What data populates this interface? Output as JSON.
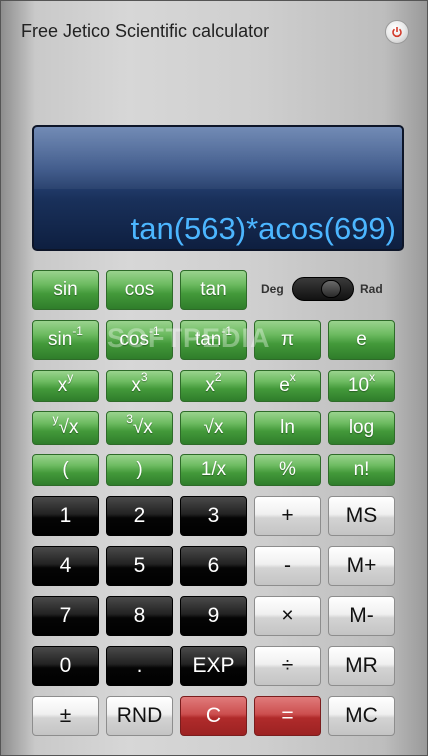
{
  "window": {
    "title": "Free Jetico Scientific calculator"
  },
  "display": {
    "expression": "tan(563)*acos(699)"
  },
  "angle_mode": {
    "deg_label": "Deg",
    "rad_label": "Rad",
    "selected": "Rad"
  },
  "watermark": "SOFTPEDIA",
  "buttons": {
    "sin": "sin",
    "cos": "cos",
    "tan": "tan",
    "asin_base": "sin",
    "acos_base": "cos",
    "atan_base": "tan",
    "inv_sup": "-1",
    "pi": "π",
    "e": "e",
    "x_pow_y_base": "x",
    "x_pow_y_sup": "y",
    "x_cube_base": "x",
    "x_cube_sup": "3",
    "x_sq_base": "x",
    "x_sq_sup": "2",
    "exp_base": "e",
    "exp_sup": "x",
    "ten_pow_base": "10",
    "ten_pow_sup": "x",
    "yroot_sup": "y",
    "yroot_base": "√x",
    "croot_sup": "3",
    "croot_base": "√x",
    "sqrt": "√x",
    "ln": "ln",
    "log": "log",
    "lparen": "(",
    "rparen": ")",
    "recip": "1/x",
    "percent": "%",
    "fact": "n!",
    "n1": "1",
    "n2": "2",
    "n3": "3",
    "n4": "4",
    "n5": "5",
    "n6": "6",
    "n7": "7",
    "n8": "8",
    "n9": "9",
    "n0": "0",
    "dot": ".",
    "exp_key": "EXP",
    "plus": "+",
    "minus": "-",
    "times": "×",
    "divide": "÷",
    "equals": "=",
    "ms": "MS",
    "mplus": "M+",
    "mminus": "M-",
    "mr": "MR",
    "mc": "MC",
    "plusminus": "±",
    "rnd": "RND",
    "clear": "C"
  }
}
